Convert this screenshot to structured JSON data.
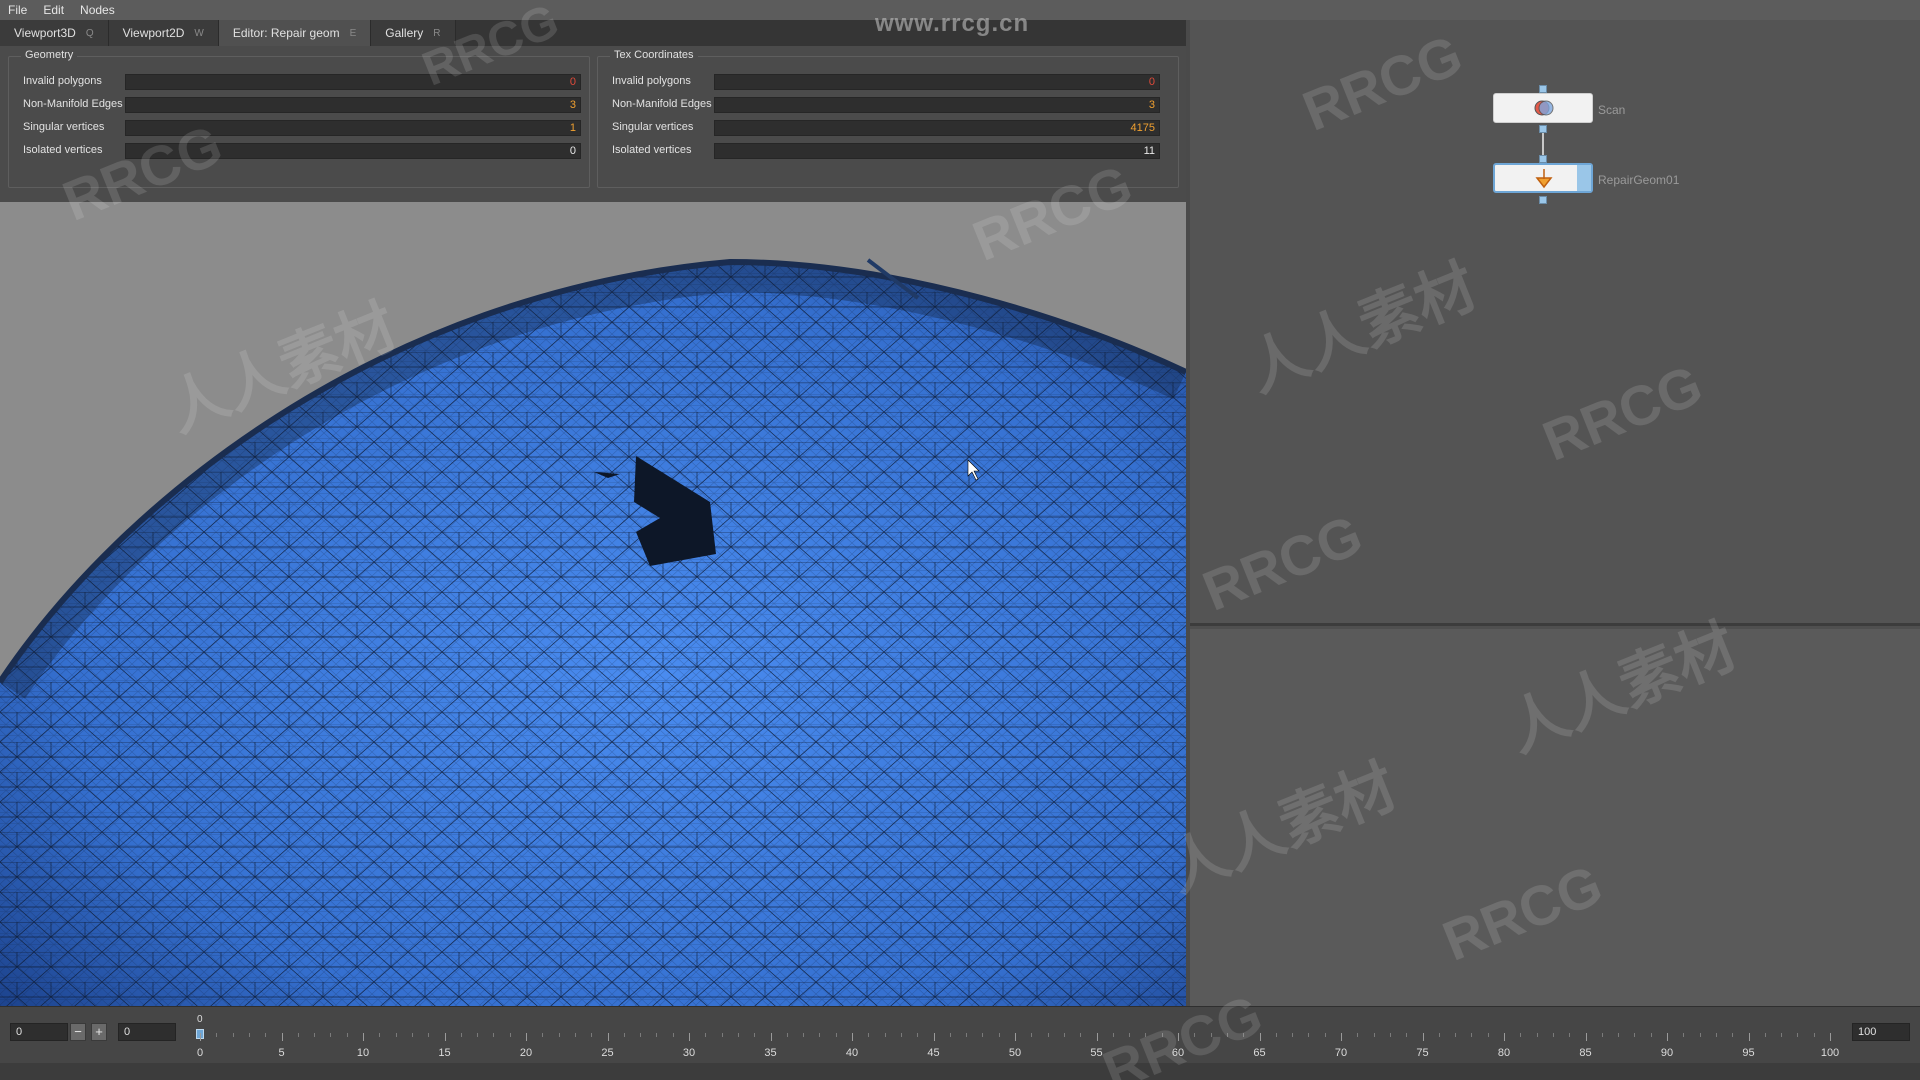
{
  "watermark_url": "www.rrcg.cn",
  "menu": [
    "File",
    "Edit",
    "Nodes"
  ],
  "tabs": [
    {
      "label": "Viewport3D",
      "key": "Q"
    },
    {
      "label": "Viewport2D",
      "key": "W"
    },
    {
      "label": "Editor: Repair geom",
      "key": "E"
    },
    {
      "label": "Gallery",
      "key": "R"
    }
  ],
  "geometry": {
    "title": "Geometry",
    "rows": [
      {
        "label": "Invalid polygons",
        "value": "0",
        "color": "#e04a3a"
      },
      {
        "label": "Non-Manifold Edges",
        "value": "3",
        "color": "#f0a030"
      },
      {
        "label": "Singular vertices",
        "value": "1",
        "color": "#f0a030"
      },
      {
        "label": "Isolated vertices",
        "value": "0",
        "color": "#e8e8e8"
      }
    ]
  },
  "tex_coordinates": {
    "title": "Tex Coordinates",
    "rows": [
      {
        "label": "Invalid polygons",
        "value": "0",
        "color": "#e04a3a"
      },
      {
        "label": "Non-Manifold Edges",
        "value": "3",
        "color": "#f0a030"
      },
      {
        "label": "Singular vertices",
        "value": "4175",
        "color": "#f0a030"
      },
      {
        "label": "Isolated vertices",
        "value": "11",
        "color": "#e8e8e8"
      }
    ]
  },
  "nodes": {
    "scan": {
      "label": "Scan",
      "icon": "scan-node-icon"
    },
    "repair": {
      "label": "RepairGeom01",
      "icon": "repair-node-icon"
    }
  },
  "timeline": {
    "start_frame": "0",
    "current_frame": "0",
    "playhead_label": "0",
    "end_frame": "100",
    "tick_labels": [
      "0",
      "5",
      "10",
      "15",
      "20",
      "25",
      "30",
      "35",
      "40",
      "45",
      "50",
      "55",
      "60",
      "65",
      "70",
      "75",
      "80",
      "85",
      "90",
      "95",
      "100"
    ]
  },
  "watermarks": [
    "RRCG",
    "人人素材"
  ],
  "colors": {
    "mesh_fill": "#3a78e0",
    "mesh_wire": "#10203a",
    "selection": "#6ea6d6"
  }
}
